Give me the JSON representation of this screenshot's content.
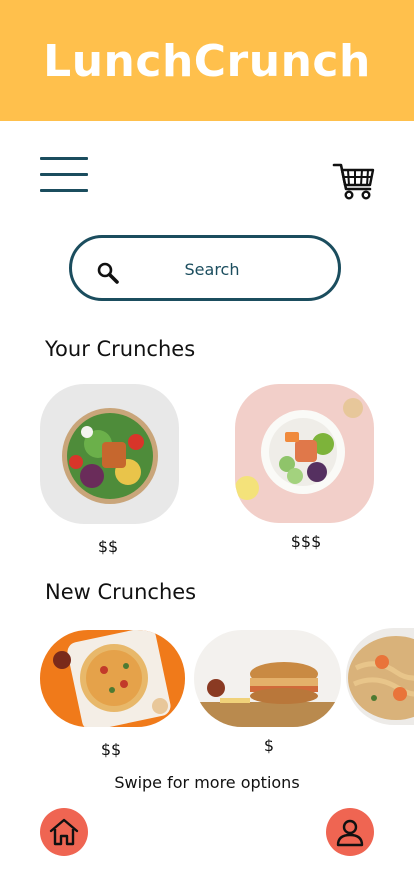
{
  "app": {
    "title": "LunchCrunch"
  },
  "colors": {
    "header": "#FFC04C",
    "accent": "#1B4D5E",
    "nav_button": "#EF6552"
  },
  "icons": {
    "menu": "hamburger-menu-icon",
    "cart": "shopping-cart-icon",
    "search": "magnifier-icon",
    "home": "home-icon",
    "profile": "user-icon"
  },
  "search": {
    "placeholder": "Search"
  },
  "your_crunches": {
    "title": "Your Crunches",
    "items": [
      {
        "image": "salad-bowl-with-salmon",
        "price": "$$"
      },
      {
        "image": "poke-bowl-with-salmon",
        "price": "$$$"
      }
    ]
  },
  "new_crunches": {
    "title": "New Crunches",
    "items": [
      {
        "image": "pizza",
        "price": "$$"
      },
      {
        "image": "sandwich",
        "price": "$"
      },
      {
        "image": "noodles-with-shrimp",
        "price": ""
      }
    ]
  },
  "footer": {
    "swipe_hint": "Swipe for more options"
  }
}
